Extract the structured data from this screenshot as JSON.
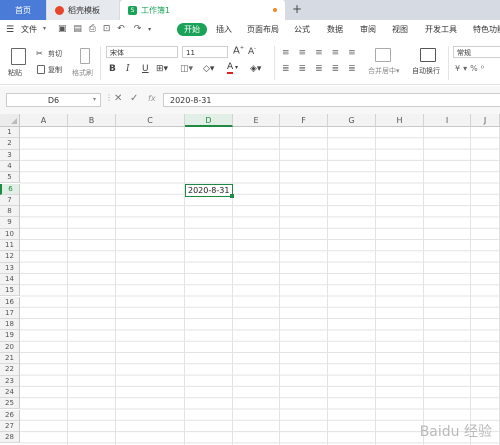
{
  "tabs": {
    "home": "首页",
    "docer": "稻壳模板",
    "workbook": "工作簿1",
    "new_tab": "+"
  },
  "menu": {
    "file": "文件",
    "items": [
      "开始",
      "插入",
      "页面布局",
      "公式",
      "数据",
      "审阅",
      "视图",
      "开发工具",
      "特色功能"
    ]
  },
  "ribbon": {
    "paste": "粘贴",
    "cut": "剪切",
    "copy": "复制",
    "format_painter": "格式刷",
    "font_name": "宋体",
    "font_size": "11",
    "bold": "B",
    "italic": "I",
    "underline": "U",
    "merge_center": "合并居中",
    "wrap_text": "自动换行",
    "number_format": "常规",
    "font_color": "#e02020"
  },
  "formula_bar": {
    "name_box": "D6",
    "fx": "fx",
    "value": "2020-8-31"
  },
  "sheet": {
    "columns": [
      "A",
      "B",
      "C",
      "D",
      "E",
      "F",
      "G",
      "H",
      "I",
      "J"
    ],
    "rows": [
      "1",
      "2",
      "3",
      "4",
      "5",
      "6",
      "7",
      "8",
      "9",
      "10",
      "11",
      "12",
      "13",
      "14",
      "15",
      "16",
      "17",
      "18",
      "19",
      "20",
      "21",
      "22",
      "23",
      "24",
      "25",
      "26",
      "27",
      "28"
    ],
    "active_cell": "D6",
    "active_value": "2020-8-31",
    "selected_column": "D",
    "selected_row": "6"
  },
  "watermark": "Baidu 经验"
}
